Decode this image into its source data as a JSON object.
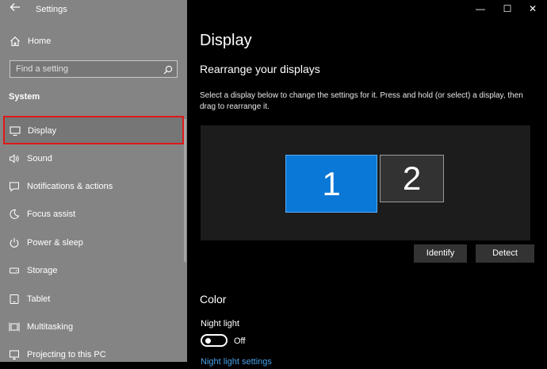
{
  "window": {
    "app_title": "Settings",
    "back_icon": "back-arrow-icon",
    "minimize_glyph": "—",
    "maximize_glyph": "☐",
    "close_glyph": "✕"
  },
  "sidebar": {
    "home_label": "Home",
    "search_placeholder": "Find a setting",
    "section_label": "System",
    "items": [
      {
        "label": "Display",
        "icon": "monitor-icon",
        "selected": true
      },
      {
        "label": "Sound",
        "icon": "speaker-icon"
      },
      {
        "label": "Notifications & actions",
        "icon": "notification-icon"
      },
      {
        "label": "Focus assist",
        "icon": "moon-icon"
      },
      {
        "label": "Power & sleep",
        "icon": "power-icon"
      },
      {
        "label": "Storage",
        "icon": "storage-icon"
      },
      {
        "label": "Tablet",
        "icon": "tablet-icon"
      },
      {
        "label": "Multitasking",
        "icon": "multitasking-icon"
      },
      {
        "label": "Projecting to this PC",
        "icon": "projector-icon"
      }
    ]
  },
  "main": {
    "page_title": "Display",
    "rearrange_heading": "Rearrange your displays",
    "rearrange_description": "Select a display below to change the settings for it. Press and hold (or select) a display, then drag to rearrange it.",
    "monitors": [
      {
        "number": "1",
        "selected": true
      },
      {
        "number": "2",
        "selected": false
      }
    ],
    "identify_label": "Identify",
    "detect_label": "Detect",
    "color_heading": "Color",
    "night_light_label": "Night light",
    "night_light_state": "Off",
    "night_light_settings_link": "Night light settings"
  },
  "colors": {
    "sidebar_bg": "#848484",
    "selected_outline": "#e01818",
    "accent": "#0a78d7",
    "link": "#4aa0e8"
  }
}
